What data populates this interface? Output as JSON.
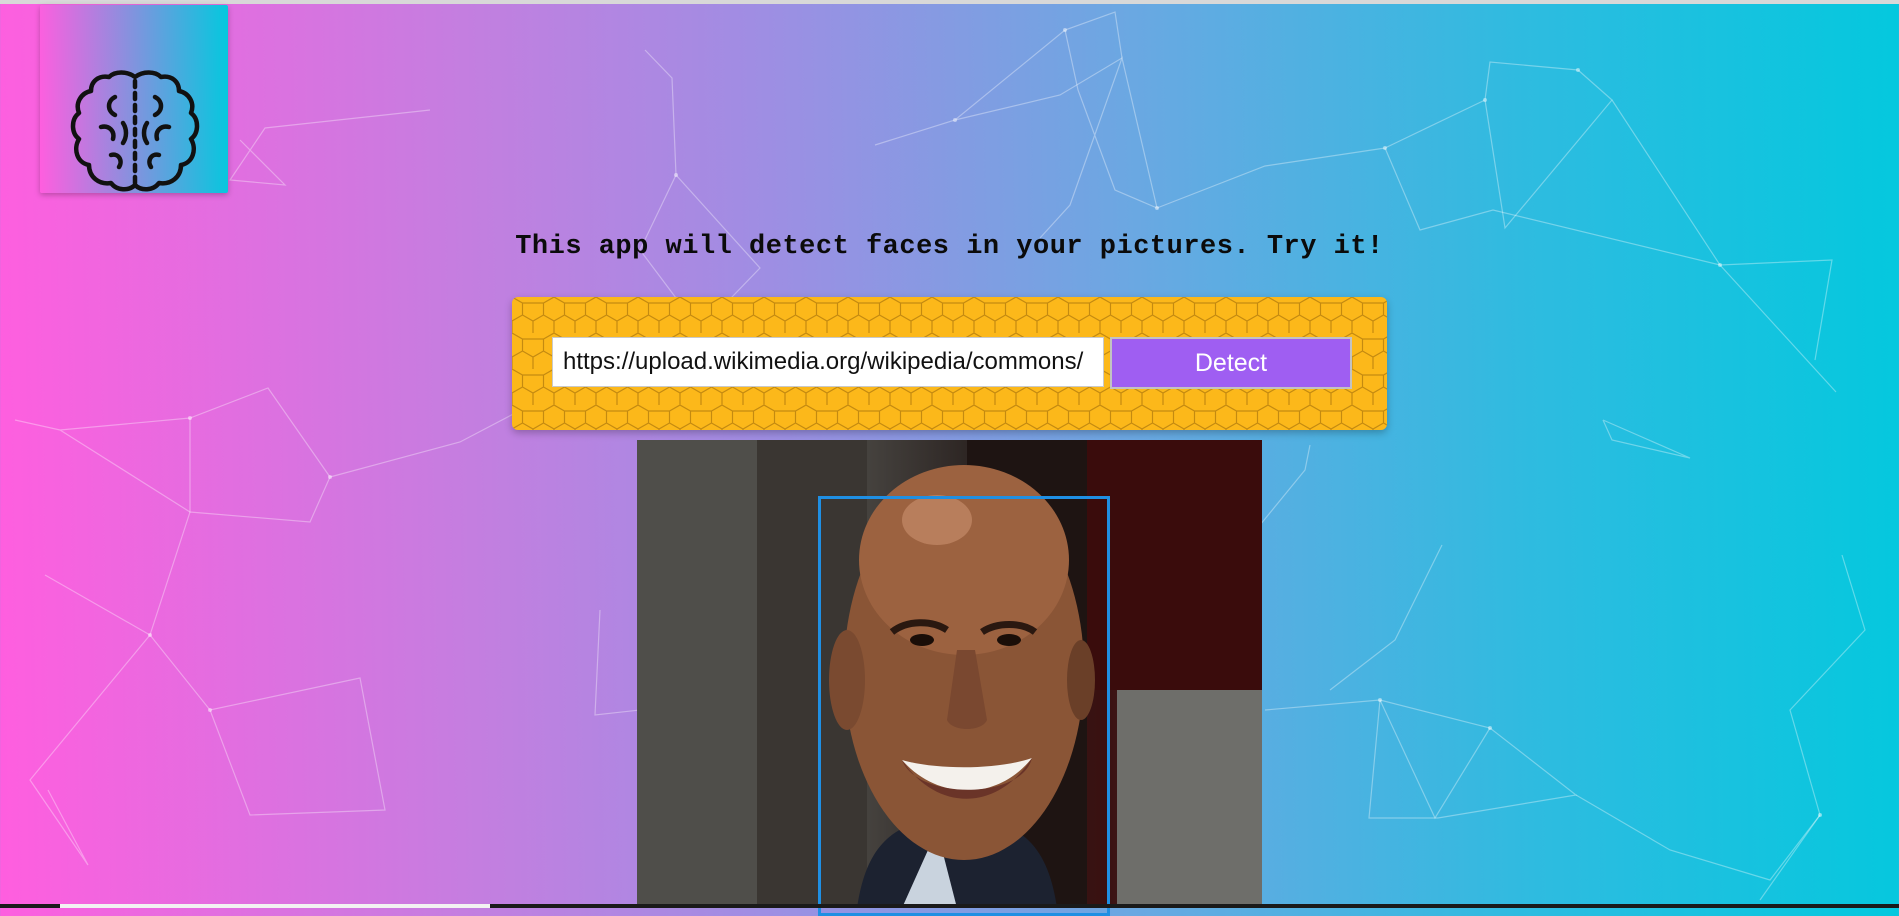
{
  "app": {
    "logo_icon": "brain-icon",
    "tagline": "This app will detect faces in your pictures. Try it!"
  },
  "form": {
    "image_url_value": "https://upload.wikimedia.org/wikipedia/commons/",
    "detect_label": "Detect"
  },
  "colors": {
    "gradient_left": "#ff5edf",
    "gradient_right": "#04c8de",
    "panel": "#fcb81a",
    "button": "#9f5ef2",
    "face_box": "#1f8fe3"
  }
}
